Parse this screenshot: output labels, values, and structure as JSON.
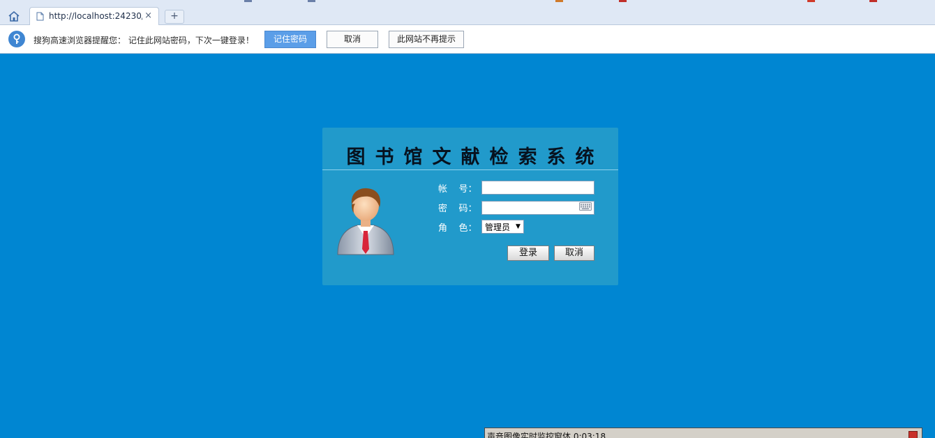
{
  "browser": {
    "tab_url": "http://localhost:24230/",
    "tab_close": "×",
    "new_tab": "+"
  },
  "password_bar": {
    "message": "搜狗高速浏览器提醒您： 记住此网站密码，下次一键登录！",
    "remember_label": "记住密码",
    "cancel_label": "取消",
    "never_label": "此网站不再提示"
  },
  "login": {
    "title": "图书馆文献检索系统",
    "account_label": "帐    号：",
    "account_value": "",
    "password_label": "密    码：",
    "password_value": "",
    "role_label": "角    色：",
    "role_selected": "管理员",
    "submit_label": "登录",
    "cancel_label": "取消"
  },
  "monitor_window": {
    "title": "声音图像实时监控窗体 0:03:18"
  },
  "colors": {
    "page_background": "#0086d2",
    "panel_background": "#219acb",
    "primary_button": "#5b9ee8"
  }
}
